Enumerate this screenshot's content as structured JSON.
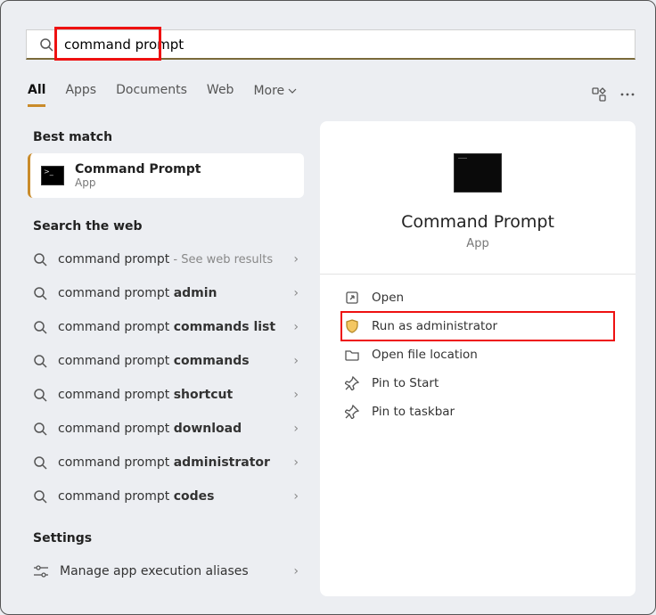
{
  "search": {
    "value": "command prompt"
  },
  "tabs": [
    "All",
    "Apps",
    "Documents",
    "Web",
    "More"
  ],
  "active_tab": 0,
  "best_match": {
    "heading": "Best match",
    "title": "Command Prompt",
    "subtitle": "App"
  },
  "web": {
    "heading": "Search the web",
    "items": [
      {
        "prefix": "command prompt",
        "bold": "",
        "muted": " - See web results"
      },
      {
        "prefix": "command prompt ",
        "bold": "admin",
        "muted": ""
      },
      {
        "prefix": "command prompt ",
        "bold": "commands list",
        "muted": ""
      },
      {
        "prefix": "command prompt ",
        "bold": "commands",
        "muted": ""
      },
      {
        "prefix": "command prompt ",
        "bold": "shortcut",
        "muted": ""
      },
      {
        "prefix": "command prompt ",
        "bold": "download",
        "muted": ""
      },
      {
        "prefix": "command prompt ",
        "bold": "administrator",
        "muted": ""
      },
      {
        "prefix": "command prompt ",
        "bold": "codes",
        "muted": ""
      }
    ]
  },
  "settings": {
    "heading": "Settings",
    "items": [
      {
        "label": "Manage app execution aliases"
      }
    ]
  },
  "detail": {
    "title": "Command Prompt",
    "type": "App",
    "actions": [
      {
        "label": "Open",
        "icon": "open"
      },
      {
        "label": "Run as administrator",
        "icon": "shield",
        "highlight": true
      },
      {
        "label": "Open file location",
        "icon": "folder"
      },
      {
        "label": "Pin to Start",
        "icon": "pin"
      },
      {
        "label": "Pin to taskbar",
        "icon": "pin"
      }
    ]
  }
}
